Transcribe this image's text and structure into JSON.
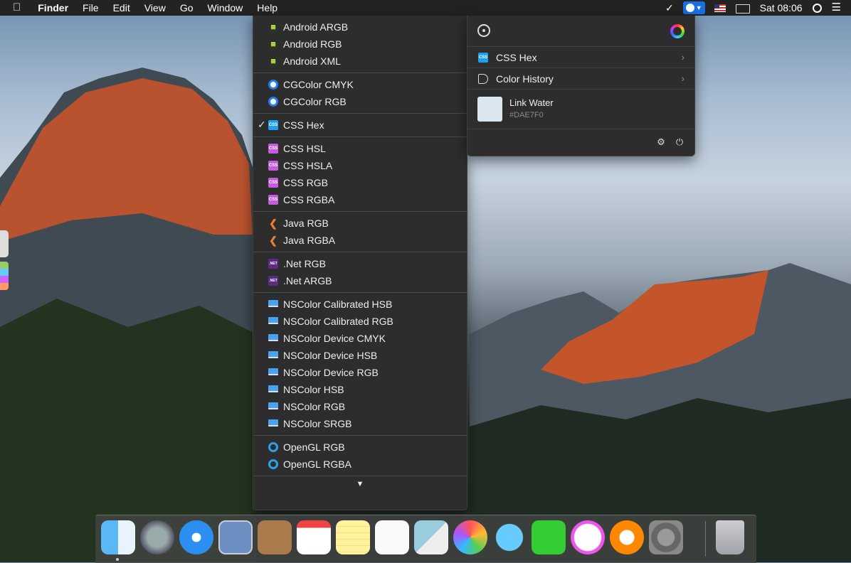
{
  "menubar": {
    "app_name": "Finder",
    "menus": [
      "File",
      "Edit",
      "View",
      "Go",
      "Window",
      "Help"
    ],
    "clock": "Sat 08:06"
  },
  "format_menu": {
    "groups": [
      {
        "items": [
          {
            "label": "Android ARGB",
            "icon": "android-icon"
          },
          {
            "label": "Android RGB",
            "icon": "android-icon"
          },
          {
            "label": "Android XML",
            "icon": "android-icon"
          }
        ]
      },
      {
        "items": [
          {
            "label": "CGColor CMYK",
            "icon": "cgcolor-icon"
          },
          {
            "label": "CGColor RGB",
            "icon": "cgcolor-icon"
          }
        ]
      },
      {
        "items": [
          {
            "label": "CSS Hex",
            "icon": "css-icon",
            "checked": true
          }
        ]
      },
      {
        "items": [
          {
            "label": "CSS HSL",
            "icon": "css-icon"
          },
          {
            "label": "CSS HSLA",
            "icon": "css-icon"
          },
          {
            "label": "CSS RGB",
            "icon": "css-icon"
          },
          {
            "label": "CSS RGBA",
            "icon": "css-icon"
          }
        ]
      },
      {
        "items": [
          {
            "label": "Java RGB",
            "icon": "java-icon"
          },
          {
            "label": "Java RGBA",
            "icon": "java-icon"
          }
        ]
      },
      {
        "items": [
          {
            "label": ".Net RGB",
            "icon": "dotnet-icon"
          },
          {
            "label": ".Net ARGB",
            "icon": "dotnet-icon"
          }
        ]
      },
      {
        "items": [
          {
            "label": "NSColor Calibrated HSB",
            "icon": "nscolor-icon"
          },
          {
            "label": "NSColor Calibrated RGB",
            "icon": "nscolor-icon"
          },
          {
            "label": "NSColor Device CMYK",
            "icon": "nscolor-icon"
          },
          {
            "label": "NSColor Device HSB",
            "icon": "nscolor-icon"
          },
          {
            "label": "NSColor Device RGB",
            "icon": "nscolor-icon"
          },
          {
            "label": "NSColor HSB",
            "icon": "nscolor-icon"
          },
          {
            "label": "NSColor RGB",
            "icon": "nscolor-icon"
          },
          {
            "label": "NSColor SRGB",
            "icon": "nscolor-icon"
          }
        ]
      },
      {
        "items": [
          {
            "label": "OpenGL RGB",
            "icon": "opengl-icon"
          },
          {
            "label": "OpenGL RGBA",
            "icon": "opengl-icon"
          }
        ]
      }
    ],
    "checkmark": "✓",
    "css_badge": "CSS",
    "net_badge": ".NET"
  },
  "picker": {
    "format_row_label": "CSS Hex",
    "history_row_label": "Color History",
    "color_name": "Link Water",
    "color_hex": "#DAE7F0",
    "swatch_color": "#DAE7F0"
  },
  "colors": {
    "menu_bg": "#2d2d2d",
    "accent_blue": "#1a6fe0",
    "android_green": "#9dd53a",
    "css_purple": "#c35be0"
  }
}
